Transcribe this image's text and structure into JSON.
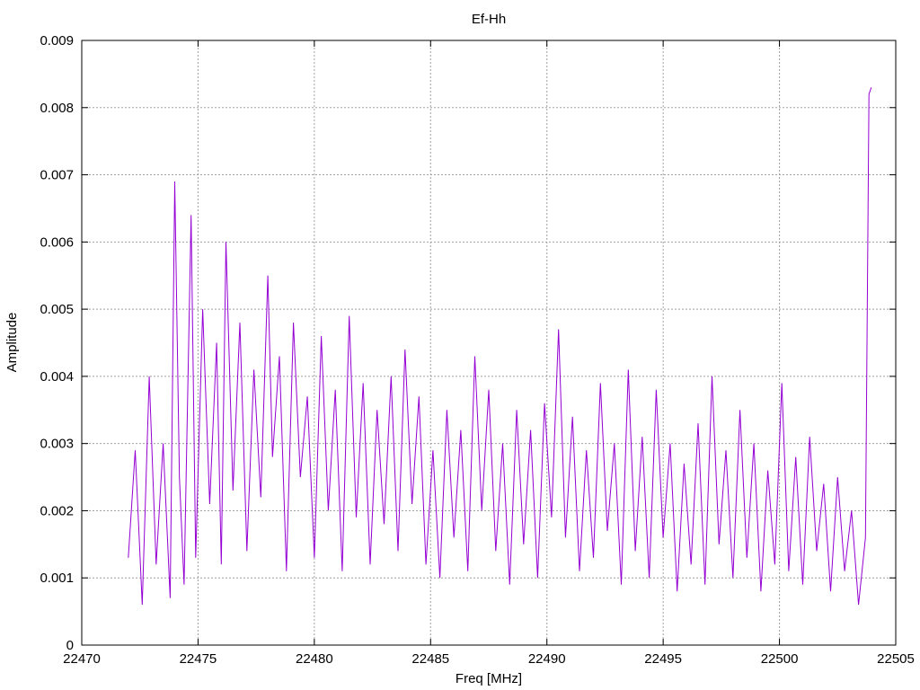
{
  "chart_data": {
    "type": "line",
    "title": "Ef-Hh",
    "xlabel": "Freq [MHz]",
    "ylabel": "Amplitude",
    "xlim": [
      22470,
      22505
    ],
    "ylim": [
      0,
      0.009
    ],
    "xticks": [
      22470,
      22475,
      22480,
      22485,
      22490,
      22495,
      22500,
      22505
    ],
    "yticks": [
      0,
      0.001,
      0.002,
      0.003,
      0.004,
      0.005,
      0.006,
      0.007,
      0.008,
      0.009
    ],
    "xtick_labels": [
      "22470",
      "22475",
      "22480",
      "22485",
      "22490",
      "22495",
      "22500",
      "22505"
    ],
    "ytick_labels": [
      "0",
      "0.001",
      "0.002",
      "0.003",
      "0.004",
      "0.005",
      "0.006",
      "0.007",
      "0.008",
      "0.009"
    ],
    "grid": true,
    "line_color": "#9400d3",
    "series": [
      {
        "x": [
          22472.0,
          22472.3,
          22472.6,
          22472.9,
          22473.2,
          22473.5,
          22473.8,
          22474.0,
          22474.2,
          22474.4,
          22474.7,
          22474.9,
          22475.2,
          22475.5,
          22475.8,
          22476.0,
          22476.2,
          22476.5,
          22476.8,
          22477.1,
          22477.4,
          22477.7,
          22478.0,
          22478.2,
          22478.5,
          22478.8,
          22479.1,
          22479.4,
          22479.7,
          22480.0,
          22480.3,
          22480.6,
          22480.9,
          22481.2,
          22481.5,
          22481.8,
          22482.1,
          22482.4,
          22482.7,
          22483.0,
          22483.3,
          22483.6,
          22483.9,
          22484.2,
          22484.5,
          22484.8,
          22485.1,
          22485.4,
          22485.7,
          22486.0,
          22486.3,
          22486.6,
          22486.9,
          22487.2,
          22487.5,
          22487.8,
          22488.1,
          22488.4,
          22488.7,
          22489.0,
          22489.3,
          22489.6,
          22489.9,
          22490.2,
          22490.5,
          22490.8,
          22491.1,
          22491.4,
          22491.7,
          22492.0,
          22492.3,
          22492.6,
          22492.9,
          22493.2,
          22493.5,
          22493.8,
          22494.1,
          22494.4,
          22494.7,
          22495.0,
          22495.3,
          22495.6,
          22495.9,
          22496.2,
          22496.5,
          22496.8,
          22497.1,
          22497.4,
          22497.7,
          22498.0,
          22498.3,
          22498.6,
          22498.9,
          22499.2,
          22499.5,
          22499.8,
          22500.1,
          22500.4,
          22500.7,
          22501.0,
          22501.3,
          22501.6,
          22501.9,
          22502.2,
          22502.5,
          22502.8,
          22503.1,
          22503.4,
          22503.7,
          22503.85,
          22503.95
        ],
        "y": [
          0.0013,
          0.0029,
          0.0006,
          0.004,
          0.0012,
          0.003,
          0.0007,
          0.0069,
          0.0025,
          0.0009,
          0.0064,
          0.0013,
          0.005,
          0.0021,
          0.0045,
          0.0012,
          0.006,
          0.0023,
          0.0048,
          0.0014,
          0.0041,
          0.0022,
          0.0055,
          0.0028,
          0.0043,
          0.0011,
          0.0048,
          0.0025,
          0.0037,
          0.0013,
          0.0046,
          0.002,
          0.0038,
          0.0011,
          0.0049,
          0.0019,
          0.0039,
          0.0012,
          0.0035,
          0.0018,
          0.004,
          0.0014,
          0.0044,
          0.0021,
          0.0037,
          0.0012,
          0.0029,
          0.001,
          0.0035,
          0.0016,
          0.0032,
          0.0011,
          0.0043,
          0.002,
          0.0038,
          0.0014,
          0.003,
          0.0009,
          0.0035,
          0.0015,
          0.0032,
          0.001,
          0.0036,
          0.0019,
          0.0047,
          0.0016,
          0.0034,
          0.0011,
          0.0029,
          0.0013,
          0.0039,
          0.0017,
          0.003,
          0.0009,
          0.0041,
          0.0014,
          0.0031,
          0.001,
          0.0038,
          0.0016,
          0.003,
          0.0008,
          0.0027,
          0.0012,
          0.0033,
          0.0009,
          0.004,
          0.0015,
          0.0029,
          0.001,
          0.0035,
          0.0013,
          0.003,
          0.0008,
          0.0026,
          0.0012,
          0.0039,
          0.0011,
          0.0028,
          0.0009,
          0.0031,
          0.0014,
          0.0024,
          0.0008,
          0.0025,
          0.0011,
          0.002,
          0.0006,
          0.0016,
          0.0082,
          0.0083
        ]
      }
    ]
  }
}
